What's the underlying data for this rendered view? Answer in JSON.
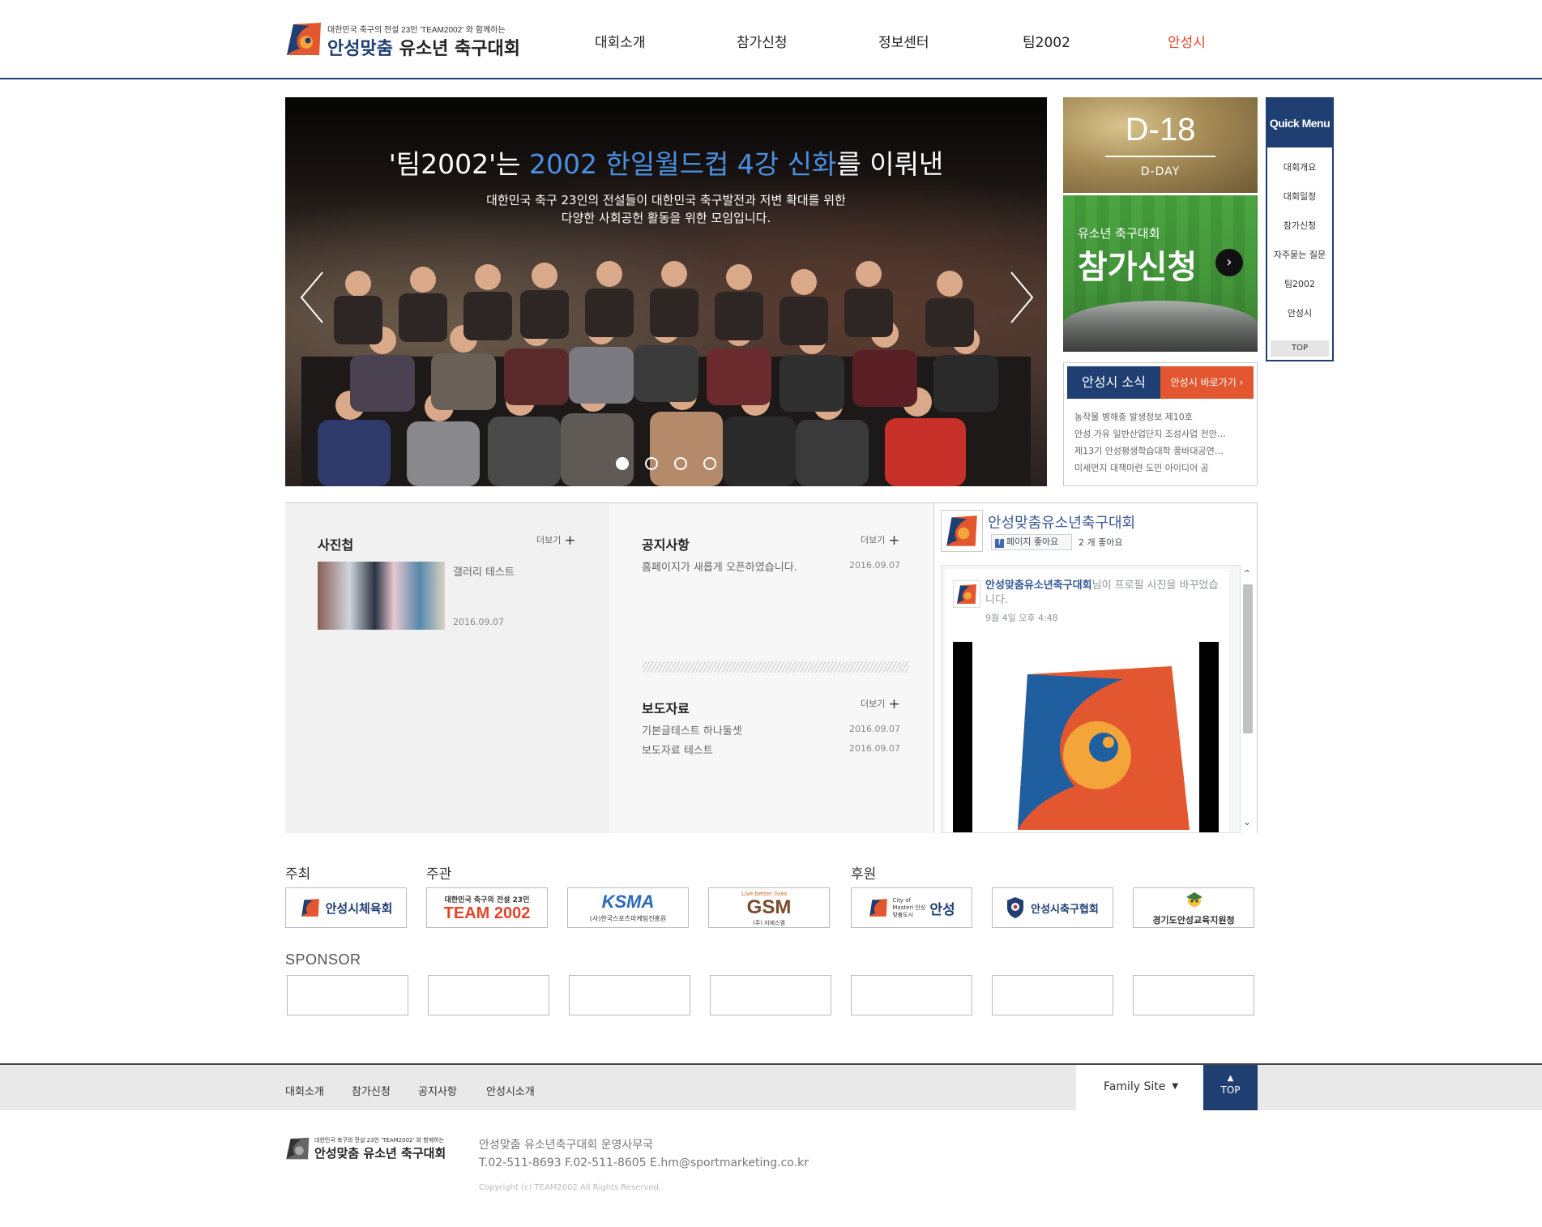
{
  "header": {
    "logo_small": "대한민국 축구의 전설 23인 'TEAM2002' 와 함께하는",
    "logo_title_blue": "안성맞춤",
    "logo_title_rest": " 유소년 축구대회",
    "nav": [
      {
        "label": "대회소개"
      },
      {
        "label": "참가신청"
      },
      {
        "label": "정보센터"
      },
      {
        "label": "팀2002"
      },
      {
        "label": "안성시"
      }
    ]
  },
  "hero": {
    "title_prefix": "'팀2002'는 ",
    "title_highlight": "2002 한일월드컵 4강 신화",
    "title_suffix": "를 이뤄낸",
    "sub_line1": "대한민국 축구 23인의 전설들이 대한민국 축구발전과 저변 확대를 위한",
    "sub_line2": "다양한 사회공헌 활동을 위한 모임입니다.",
    "slide_count": 4,
    "active_slide": 1
  },
  "dday": {
    "number": "D-18",
    "label": "D-DAY"
  },
  "apply": {
    "small": "유소년 축구대회",
    "big": "참가신청",
    "go": "›"
  },
  "news": {
    "tab_active": "안성시 소식",
    "tab_link": "안성시 바로가기 ›",
    "items": [
      "농작물 병해충 발생정보 제10호",
      "안성 가유 일반산업단지 조성사업 전안…",
      "제13기 안성평생학습대학 풍바대공연…",
      "미세먼지 대책마련 도민 아이디어 공"
    ]
  },
  "quick": {
    "title": "Quick Menu",
    "items": [
      "대회개요",
      "대회일정",
      "참가신청",
      "자주묻는 질문",
      "팀2002",
      "안성시"
    ],
    "top": "TOP"
  },
  "photo": {
    "title": "사진첩",
    "more": "더보기",
    "caption": "갤러리 테스트",
    "date": "2016.09.07"
  },
  "notice": {
    "title": "공지사항",
    "more": "더보기",
    "rows": [
      {
        "text": "홈페이지가 새롭게 오픈하였습니다.",
        "date": "2016.09.07"
      }
    ]
  },
  "press": {
    "title": "보도자료",
    "more": "더보기",
    "rows": [
      {
        "text": "기본글테스트 하나둘셋",
        "date": "2016.09.07"
      },
      {
        "text": "보도자료 테스트",
        "date": "2016.09.07"
      }
    ]
  },
  "facebook": {
    "page_name": "안성맞춤유소년축구대회",
    "like_button": "페이지 좋아요",
    "likes": "2 개 좋아요",
    "post_name": "안성맞춤유소년축구대회",
    "post_action": "님이 프로필 사진을 바꾸었습니다.",
    "post_time": "9월 4일 오후 4:48"
  },
  "partners": {
    "host_label": "주최",
    "organizer_label": "주관",
    "support_label": "후원",
    "logos": [
      "안성시체육회",
      "TEAM 2002",
      "KSMA",
      "GSM",
      "안성",
      "안성시축구협회",
      "경기도안성교육지원청"
    ],
    "team2002_small": "대한민국 축구의 전설 23인",
    "ksma_small": "(사)한국스포츠마케팅진흥원",
    "gsm_top": "Live better lives",
    "gsm_bottom": "(주) 지에스엠",
    "anseong_small": "City of Masteri 안성맞춤도시"
  },
  "sponsor": {
    "label": "SPONSOR",
    "slots": 7
  },
  "footer": {
    "links": [
      "대회소개",
      "참가신청",
      "공지사항",
      "안성시소개"
    ],
    "family_site": "Family Site",
    "top": "TOP",
    "logo_small": "대한민국 축구의 전설 23인 'TEAM2002' 와 함께하는",
    "logo_title": "안성맞춤 유소년 축구대회",
    "office": "안성맞춤 유소년축구대회 운영사무국",
    "contact": "T.02-511-8693 F.02-511-8605 E.hm@sportmarketing.co.kr",
    "copyright": "Copyright (c) TEAM2002 All Rights Reserved."
  },
  "colors": {
    "navy": "#1f3f73",
    "accent": "#e2442a",
    "hero_highlight": "#4a90e2",
    "facebook_blue": "#3b5998"
  }
}
